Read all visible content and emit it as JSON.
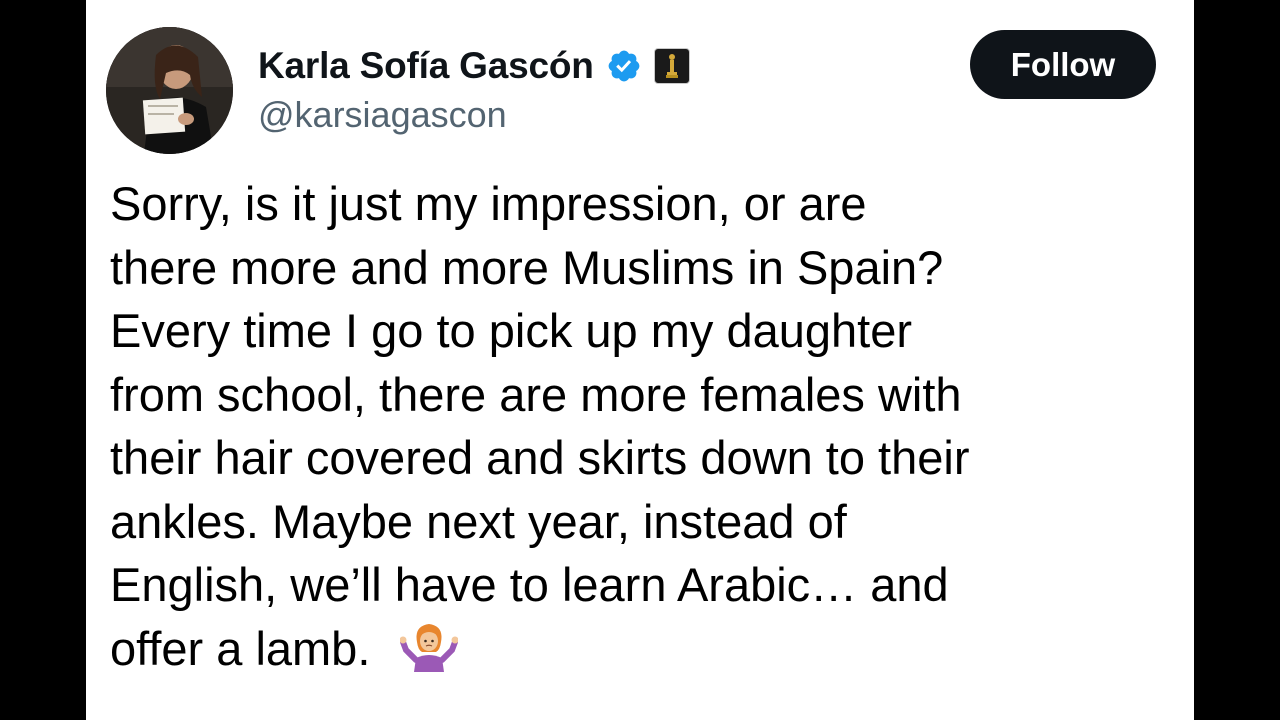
{
  "author": {
    "display_name": "Karla Sofía Gascón",
    "handle": "@karsiagascon",
    "verified_icon": "verified-checkmark-icon",
    "verified_color": "#1d9bf0",
    "affiliate_badge_icon": "award-statuette-icon"
  },
  "actions": {
    "follow_label": "Follow"
  },
  "tweet": {
    "lines": [
      "Sorry, is it just my impression, or are",
      "there more and more Muslims in Spain?",
      "Every time I go to pick up my daughter",
      "from school, there are more females with",
      "their hair covered and skirts down to their",
      "ankles. Maybe next year, instead of",
      "English, we’ll have to learn Arabic… and",
      "offer a lamb."
    ],
    "emoji_icon": "person-shrugging-icon"
  }
}
